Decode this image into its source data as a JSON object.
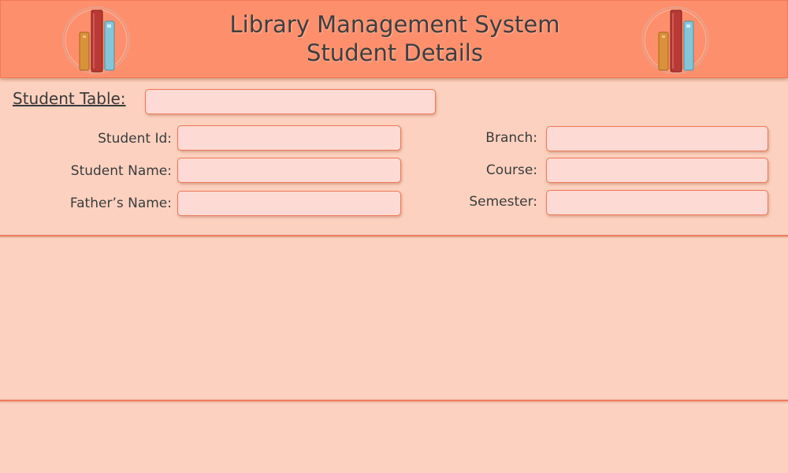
{
  "header": {
    "title_line1": "Library Management System",
    "title_line2": "Student Details",
    "logo_icon": "books-icon"
  },
  "form": {
    "table_label": "Student Table:",
    "table_value": "",
    "left_fields": [
      {
        "label": "Student Id:",
        "value": ""
      },
      {
        "label": "Student Name:",
        "value": ""
      },
      {
        "label": "Father’s Name:",
        "value": ""
      }
    ],
    "right_fields": [
      {
        "label": "Branch:",
        "value": ""
      },
      {
        "label": "Course:",
        "value": ""
      },
      {
        "label": "Semester:",
        "value": ""
      }
    ]
  },
  "colors": {
    "background": "#fcd1bf",
    "header": "#fd8f6c",
    "field_fill": "#fddad3",
    "field_border": "#ee785a"
  }
}
